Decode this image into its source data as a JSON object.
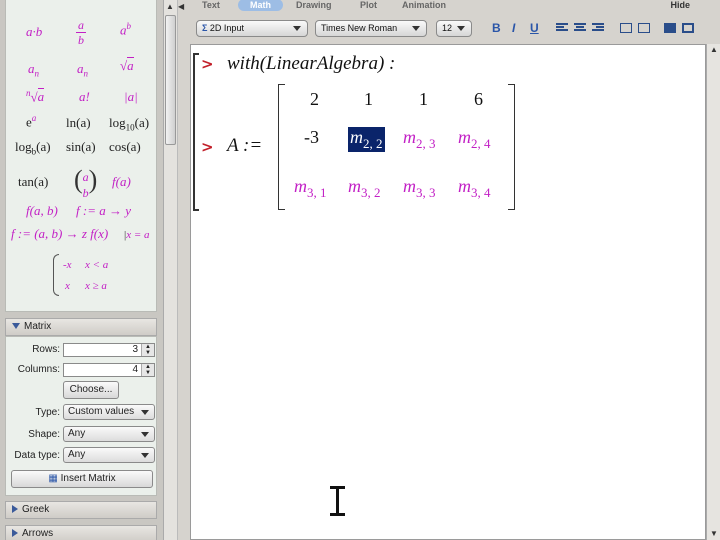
{
  "tabs": [
    {
      "label": "Text"
    },
    {
      "label": "Math",
      "active": true
    },
    {
      "label": "Drawing"
    },
    {
      "label": "Plot"
    },
    {
      "label": "Animation"
    }
  ],
  "hide_label": "Hide",
  "toolbar": {
    "input_mode": "2D Input",
    "font": "Times New Roman",
    "font_size": "12",
    "bold": "B",
    "italic": "I",
    "underline": "U"
  },
  "palette": {
    "expression_items": [
      "a·b",
      "a",
      "b",
      "a",
      "b",
      "a",
      "n",
      "a",
      "n",
      "a",
      "n",
      "a",
      "a!",
      "|a|",
      "e",
      "a",
      "ln(a)",
      "log",
      "10",
      "(a)",
      "log",
      "b",
      "(a)",
      "sin(a)",
      "cos(a)",
      "tan(a)",
      "a",
      "b",
      "f(a)",
      "f(a, b)",
      "f := a → y",
      "f := (a, b) → z",
      "f(x)",
      "x = a",
      "-x",
      "x < a",
      "x",
      "x ≥ a"
    ]
  },
  "matrix_palette": {
    "header": "Matrix",
    "rows_label": "Rows:",
    "rows_value": "3",
    "columns_label": "Columns:",
    "columns_value": "4",
    "choose_label": "Choose...",
    "type_label": "Type:",
    "type_value": "Custom values",
    "shape_label": "Shape:",
    "shape_value": "Any",
    "datatype_label": "Data type:",
    "datatype_value": "Any",
    "insert_label": "Insert Matrix"
  },
  "sections": {
    "greek": "Greek",
    "arrows": "Arrows"
  },
  "worksheet": {
    "prompt": ">",
    "line1": "with(LinearAlgebra) :",
    "assign_lhs": "A :=",
    "matrix": {
      "rows": [
        [
          {
            "t": "2"
          },
          {
            "t": "1"
          },
          {
            "t": "1"
          },
          {
            "t": "6"
          }
        ],
        [
          {
            "t": "-3"
          },
          {
            "t": "m",
            "sub": "2, 2",
            "selected": true
          },
          {
            "t": "m",
            "sub": "2, 3"
          },
          {
            "t": "m",
            "sub": "2, 4"
          }
        ],
        [
          {
            "t": "m",
            "sub": "3, 1"
          },
          {
            "t": "m",
            "sub": "3, 2"
          },
          {
            "t": "m",
            "sub": "3, 3"
          },
          {
            "t": "m",
            "sub": "3, 4"
          }
        ]
      ]
    }
  }
}
